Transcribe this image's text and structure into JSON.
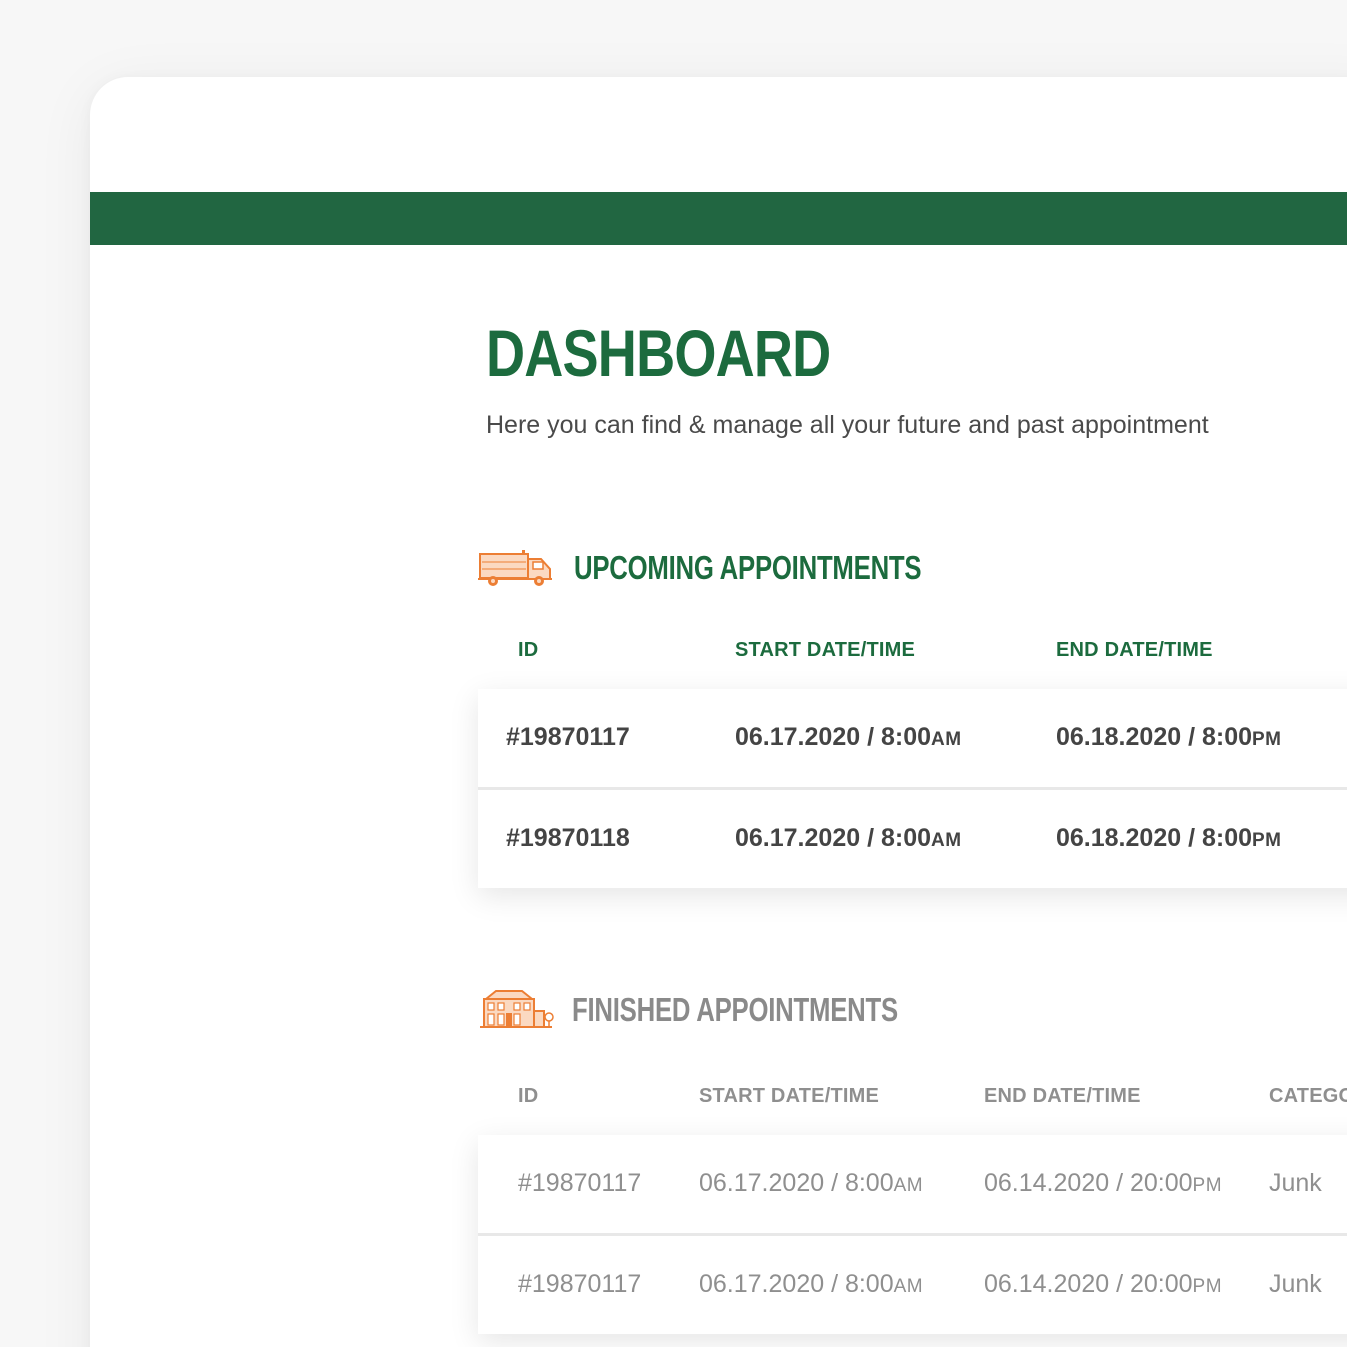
{
  "header": {
    "title": "DASHBOARD",
    "subtitle": "Here you can find & manage all your future and past appointment"
  },
  "colors": {
    "brand_green": "#216641",
    "title_green": "#1c6b3e",
    "accent_orange": "#f08a3c",
    "muted_gray": "#8f8f8f"
  },
  "upcoming": {
    "icon": "truck-icon",
    "title": "UPCOMING APPOINTMENTS",
    "columns": [
      "ID",
      "START DATE/TIME",
      "END DATE/TIME"
    ],
    "rows": [
      {
        "id": "#19870117",
        "start": "06.17.2020 / 8:00",
        "start_ampm": "AM",
        "end": "06.18.2020 / 8:00",
        "end_ampm": "PM"
      },
      {
        "id": "#19870118",
        "start": "06.17.2020 / 8:00",
        "start_ampm": "AM",
        "end": "06.18.2020 / 8:00",
        "end_ampm": "PM"
      }
    ]
  },
  "finished": {
    "icon": "house-icon",
    "title": "FINISHED APPOINTMENTS",
    "columns": [
      "ID",
      "START DATE/TIME",
      "END DATE/TIME",
      "CATEGO"
    ],
    "rows": [
      {
        "id": "#19870117",
        "start": "06.17.2020 / 8:00",
        "start_ampm": "AM",
        "end": "06.14.2020 / 20:00",
        "end_ampm": "PM",
        "category": "Junk"
      },
      {
        "id": "#19870117",
        "start": "06.17.2020 / 8:00",
        "start_ampm": "AM",
        "end": "06.14.2020 / 20:00",
        "end_ampm": "PM",
        "category": "Junk"
      }
    ]
  }
}
